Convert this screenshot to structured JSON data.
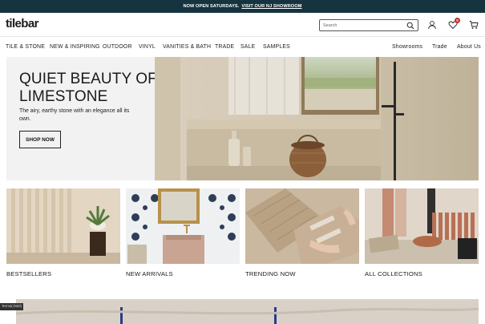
{
  "announcement": {
    "text": "NOW OPEN SATURDAYS.",
    "link": "VISIT OUR NJ SHOWROOM"
  },
  "header": {
    "logo": "tilebar",
    "search": {
      "placeholder": "Search"
    },
    "cart_count": "0"
  },
  "nav": {
    "left": [
      "TILE & STONE",
      "NEW & INSPIRING",
      "OUTDOOR",
      "VINYL",
      "VANITIES & BATH",
      "TRADE",
      "SALE",
      "SAMPLES"
    ],
    "right": [
      "Showrooms",
      "Trade",
      "About Us"
    ]
  },
  "hero": {
    "title": "QUIET BEAUTY OF LIMESTONE",
    "subtitle": "The airy, earthy stone with an elegance all its own.",
    "button": "SHOP NOW"
  },
  "tiles": [
    {
      "label": "BESTSELLERS"
    },
    {
      "label": "NEW ARRIVALS"
    },
    {
      "label": "TRENDING NOW"
    },
    {
      "label": "ALL COLLECTIONS"
    }
  ],
  "corner_tag": "Terms(.html)",
  "colors": {
    "announcement_bg": "#16343f",
    "badge": "#c0302a"
  }
}
